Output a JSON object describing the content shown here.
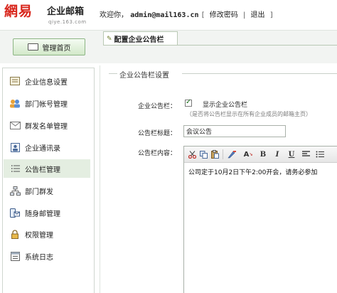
{
  "header": {
    "brand": "網易",
    "product": "企业邮箱",
    "domain": "qiye.163.com",
    "welcome": "欢迎你，",
    "email": "admin@mail163.cn",
    "bracket_open": "[",
    "change_password": "修改密码",
    "logout": "退出",
    "bracket_close": "]",
    "separator": "|"
  },
  "topbar": {
    "admin_home": "管理首页",
    "active_tab": "配置企业公告栏"
  },
  "sidebar": {
    "items": [
      {
        "label": "企业信息设置",
        "icon": "info-settings-icon"
      },
      {
        "label": "部门帐号管理",
        "icon": "users-icon"
      },
      {
        "label": "群发名单管理",
        "icon": "mail-list-icon"
      },
      {
        "label": "企业通讯录",
        "icon": "address-book-icon"
      },
      {
        "label": "公告栏管理",
        "icon": "bulletin-icon"
      },
      {
        "label": "部门群发",
        "icon": "department-icon"
      },
      {
        "label": "随身邮管理",
        "icon": "mobile-mail-icon"
      },
      {
        "label": "权限管理",
        "icon": "lock-icon"
      },
      {
        "label": "系统日志",
        "icon": "log-icon"
      }
    ],
    "active_index": 4
  },
  "form": {
    "section_title": "企业公告栏设置",
    "bulletin_label": "企业公告栏：",
    "show_checkbox_checked": true,
    "show_checkbox_label": "显示企业公告栏",
    "show_hint": "（是否将公告栏显示在所有企业成员的邮箱主页）",
    "title_label": "公告栏标题：",
    "title_value": "会议公告",
    "content_label": "公告栏内容：",
    "content_value": "公司定于10月2日下午2:00开会，请务必参加"
  },
  "toolbar": {
    "cut": "cut-icon",
    "copy": "copy-icon",
    "paste": "paste-icon",
    "font_color": "font-color-icon",
    "font_size": "font-size-icon",
    "bold": "B",
    "italic": "I",
    "underline": "U",
    "align": "align-icon",
    "list": "list-icon"
  },
  "colors": {
    "brand_red": "#d8261c",
    "active_item_bg": "#e4eee1",
    "button_green": "#d3e9ca"
  }
}
